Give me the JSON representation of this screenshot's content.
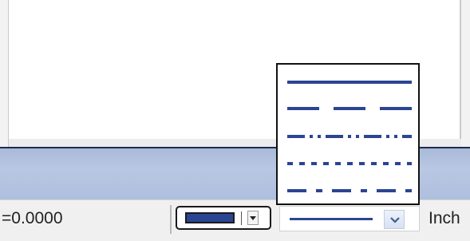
{
  "status_bar": {
    "coordinate_readout": "=0.0000",
    "units_label": "Inch",
    "color_picker": {
      "selected_color": "#2b4593",
      "icon": "chevron-down-icon"
    },
    "linetype": {
      "selected": "solid",
      "icon": "chevron-down-icon"
    }
  },
  "linetype_dropdown": {
    "line_color": "#2b4593",
    "options": [
      "solid",
      "dashed",
      "dash-dot-dot",
      "dotted",
      "dash-dot"
    ]
  }
}
